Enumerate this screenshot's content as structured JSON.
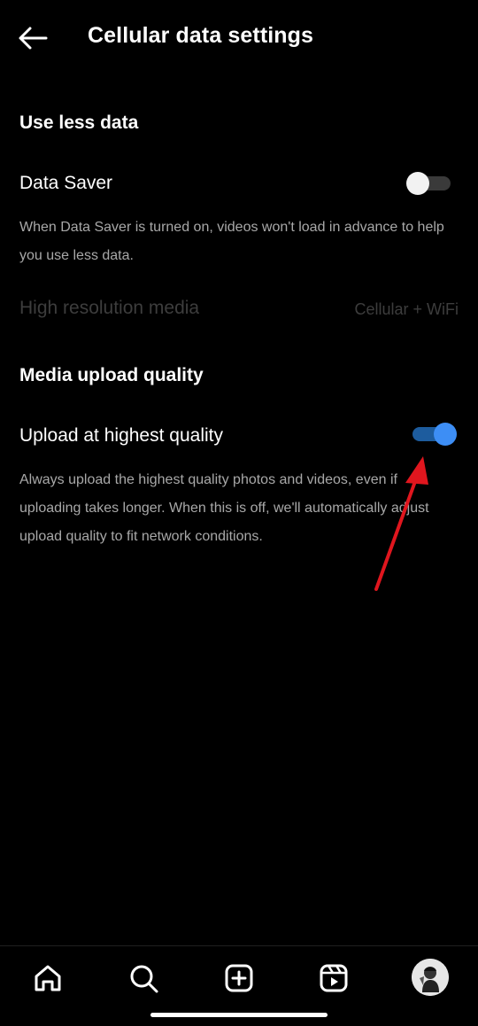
{
  "header": {
    "title": "Cellular data settings",
    "back_icon": "arrow-left-icon"
  },
  "use_less_data": {
    "heading": "Use less data",
    "data_saver": {
      "label": "Data Saver",
      "enabled": false,
      "description": "When Data Saver is turned on, videos won't load in advance to help you use less data."
    },
    "high_resolution_media": {
      "label": "High resolution media",
      "value": "Cellular + WiFi",
      "disabled": true
    }
  },
  "media_upload_quality": {
    "heading": "Media upload quality",
    "upload_highest": {
      "label": "Upload at highest quality",
      "enabled": true,
      "description": "Always upload the highest quality photos and videos, even if uploading takes longer. When this is off, we'll automatically adjust upload quality to fit network conditions."
    }
  },
  "bottom_nav": {
    "items": [
      {
        "icon": "home-icon"
      },
      {
        "icon": "search-icon"
      },
      {
        "icon": "create-plus-icon"
      },
      {
        "icon": "reels-icon"
      },
      {
        "icon": "profile-avatar"
      }
    ]
  },
  "colors": {
    "background": "#000000",
    "toggle_on_thumb": "#3d8ef5",
    "toggle_on_track": "#1d5c9e",
    "toggle_off_thumb": "#f2f2f2",
    "toggle_off_track": "#3a3a3a",
    "secondary_text": "#a8a8a8",
    "disabled_text": "#3d3d3d",
    "annotation_arrow": "#e0161e"
  }
}
